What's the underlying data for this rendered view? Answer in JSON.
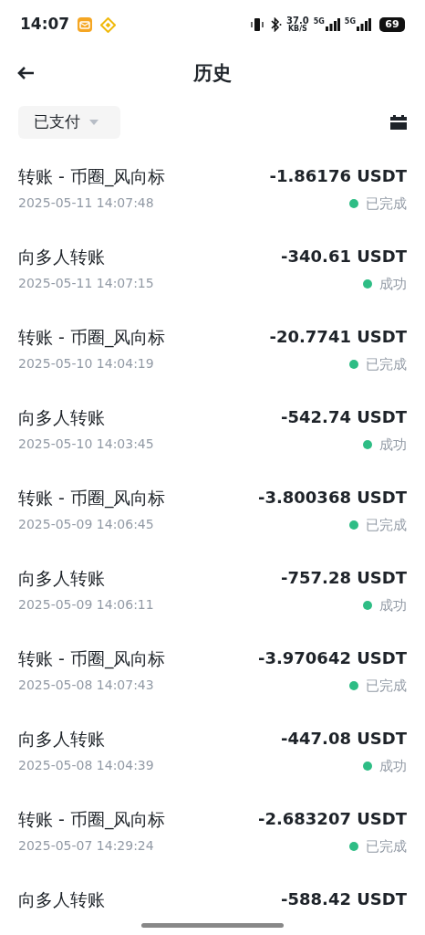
{
  "status_bar": {
    "time": "14:07",
    "net_speed": "37.0",
    "net_unit": "KB/S",
    "sim1": "5G",
    "sim2": "5G",
    "battery": "69"
  },
  "header": {
    "title": "历史"
  },
  "filter": {
    "label": "已支付"
  },
  "transactions": [
    {
      "title": "转账 - 币圈_风向标",
      "time": "2025-05-11 14:07:48",
      "amount": "-1.86176 USDT",
      "status": "已完成"
    },
    {
      "title": "向多人转账",
      "time": "2025-05-11 14:07:15",
      "amount": "-340.61 USDT",
      "status": "成功"
    },
    {
      "title": "转账 - 币圈_风向标",
      "time": "2025-05-10 14:04:19",
      "amount": "-20.7741 USDT",
      "status": "已完成"
    },
    {
      "title": "向多人转账",
      "time": "2025-05-10 14:03:45",
      "amount": "-542.74 USDT",
      "status": "成功"
    },
    {
      "title": "转账 - 币圈_风向标",
      "time": "2025-05-09 14:06:45",
      "amount": "-3.800368 USDT",
      "status": "已完成"
    },
    {
      "title": "向多人转账",
      "time": "2025-05-09 14:06:11",
      "amount": "-757.28 USDT",
      "status": "成功"
    },
    {
      "title": "转账 - 币圈_风向标",
      "time": "2025-05-08 14:07:43",
      "amount": "-3.970642 USDT",
      "status": "已完成"
    },
    {
      "title": "向多人转账",
      "time": "2025-05-08 14:04:39",
      "amount": "-447.08 USDT",
      "status": "成功"
    },
    {
      "title": "转账 - 币圈_风向标",
      "time": "2025-05-07 14:29:24",
      "amount": "-2.683207 USDT",
      "status": "已完成"
    },
    {
      "title": "向多人转账",
      "amount": "-588.42 USDT"
    }
  ]
}
